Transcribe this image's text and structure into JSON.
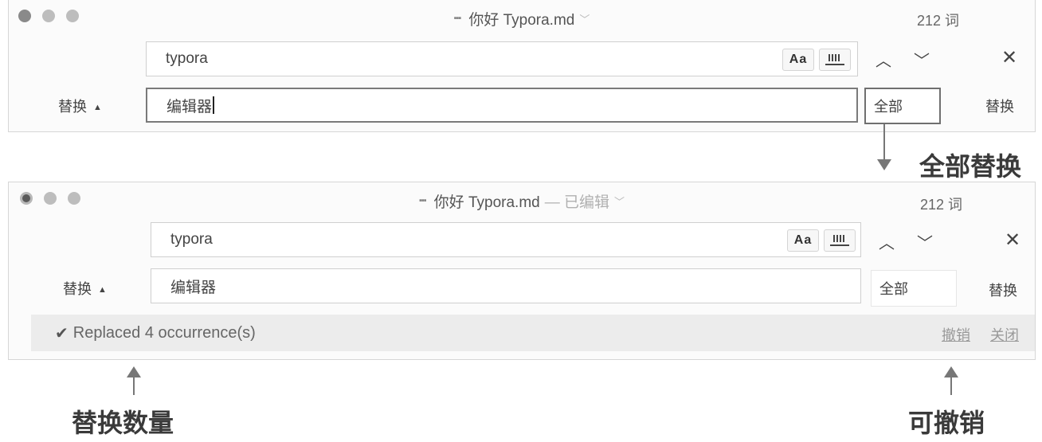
{
  "window1": {
    "title": "你好 Typora.md",
    "word_count": "212 词",
    "find_value": "typora",
    "match_case_label": "Aa",
    "replace_label": "替换",
    "replace_value": "编辑器",
    "replace_all_label": "全部",
    "replace_button_label": "替换"
  },
  "annotation_replace_all": "全部替换",
  "window2": {
    "title": "你好 Typora.md",
    "edited_suffix": "— 已编辑",
    "word_count": "212 词",
    "find_value": "typora",
    "match_case_label": "Aa",
    "replace_label": "替换",
    "replace_value": "编辑器",
    "replace_all_label": "全部",
    "replace_button_label": "替换",
    "status_message": "Replaced 4 occurrence(s)",
    "undo_label": "撤销",
    "close_label": "关闭"
  },
  "annotation_count": "替换数量",
  "annotation_undo": "可撤销"
}
